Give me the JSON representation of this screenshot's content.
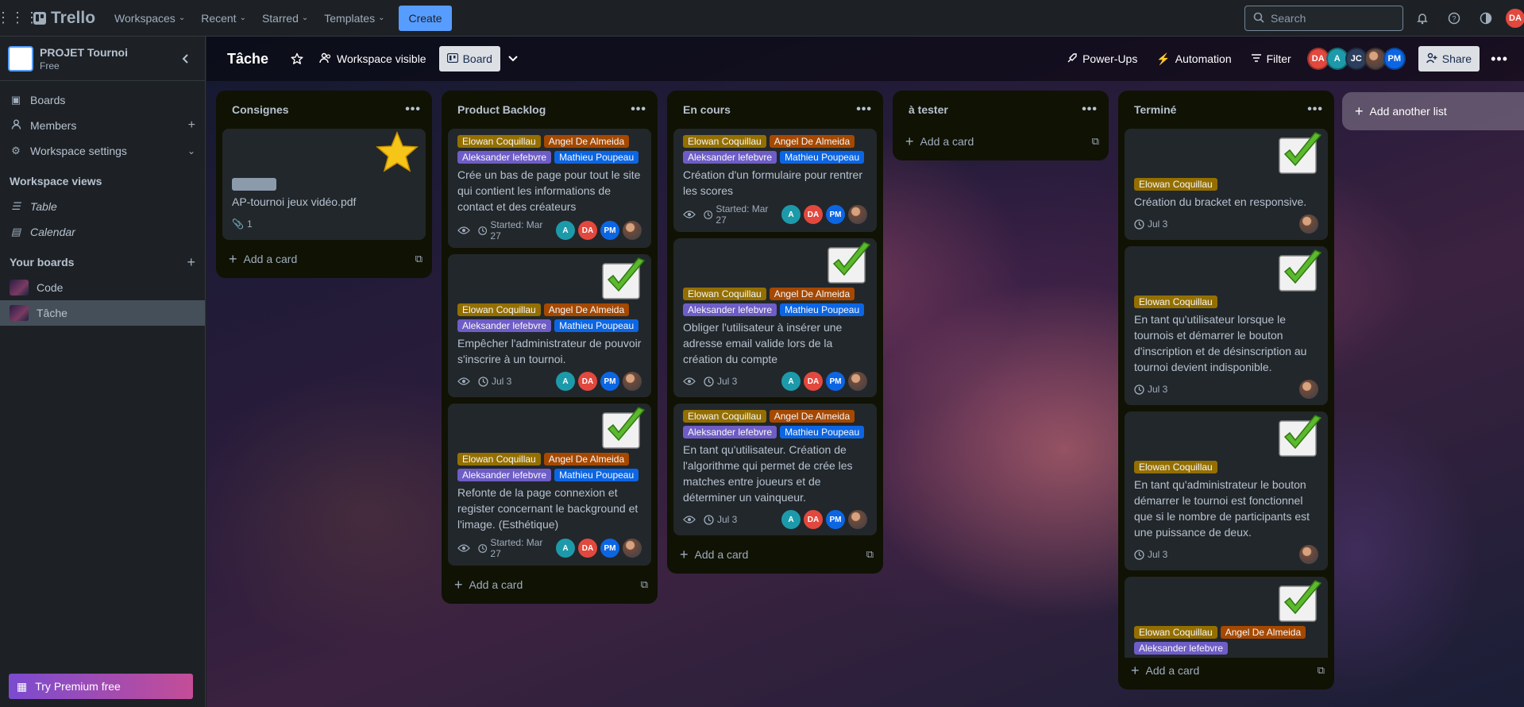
{
  "topnav": {
    "brand": "Trello",
    "menus": [
      "Workspaces",
      "Recent",
      "Starred",
      "Templates"
    ],
    "create_label": "Create",
    "search_placeholder": "Search",
    "user_initials": "DA"
  },
  "sidebar": {
    "workspace_name": "PROJET Tournoi",
    "workspace_plan": "Free",
    "items": [
      {
        "label": "Boards",
        "icon": "trello-icon"
      },
      {
        "label": "Members",
        "icon": "user-icon"
      },
      {
        "label": "Workspace settings",
        "icon": "gear-icon"
      }
    ],
    "views_heading": "Workspace views",
    "views": [
      {
        "label": "Table",
        "icon": "table-icon"
      },
      {
        "label": "Calendar",
        "icon": "calendar-icon"
      }
    ],
    "boards_heading": "Your boards",
    "boards": [
      {
        "label": "Code"
      },
      {
        "label": "Tâche"
      }
    ],
    "premium_label": "Try Premium free"
  },
  "board": {
    "title": "Tâche",
    "visibility_label": "Workspace visible",
    "view_label": "Board",
    "powerups_label": "Power-Ups",
    "automation_label": "Automation",
    "filter_label": "Filter",
    "share_label": "Share",
    "members": [
      {
        "initials": "DA",
        "color": "#e2483d"
      },
      {
        "initials": "A",
        "color": "#1d9aaa"
      },
      {
        "initials": "JC",
        "color": "#2c3e5d"
      },
      {
        "initials": "",
        "color": "#6d4a3a"
      },
      {
        "initials": "PM",
        "color": "#0c66e4"
      }
    ],
    "add_list_label": "Add another list"
  },
  "lists": [
    {
      "title": "Consignes",
      "add_card_label": "Add a card",
      "cards": [
        {
          "cover": "star",
          "title": "AP-tournoi jeux vidéo.pdf",
          "attachments": "1",
          "labels": [],
          "members": [],
          "date": ""
        }
      ]
    },
    {
      "title": "Product Backlog",
      "add_card_label": "Add a card",
      "cards": [
        {
          "cover": "",
          "labels": [
            "Elowan Coquillau",
            "Angel De Almeida",
            "Aleksander lefebvre",
            "Mathieu Poupeau"
          ],
          "title": "Crée un bas de page pour tout le site qui contient les informations de contact et des créateurs",
          "date": "Started: Mar 27",
          "members": [
            "A",
            "DA",
            "PM",
            "photo"
          ]
        },
        {
          "cover": "check",
          "labels": [
            "Elowan Coquillau",
            "Angel De Almeida",
            "Aleksander lefebvre",
            "Mathieu Poupeau"
          ],
          "title": "Empêcher l'administrateur de pouvoir s'inscrire à un tournoi.",
          "date": "Jul 3",
          "members": [
            "A",
            "DA",
            "PM",
            "photo"
          ]
        },
        {
          "cover": "check",
          "labels": [
            "Elowan Coquillau",
            "Angel De Almeida",
            "Aleksander lefebvre",
            "Mathieu Poupeau"
          ],
          "title": "Refonte de la page connexion et register concernant le background et l'image. (Esthétique)",
          "date": "Started: Mar 27",
          "members": [
            "A",
            "DA",
            "PM",
            "photo"
          ]
        }
      ]
    },
    {
      "title": "En cours",
      "add_card_label": "Add a card",
      "cards": [
        {
          "cover": "",
          "labels": [
            "Elowan Coquillau",
            "Angel De Almeida",
            "Aleksander lefebvre",
            "Mathieu Poupeau"
          ],
          "title": "Création d'un formulaire pour rentrer les scores",
          "date": "Started: Mar 27",
          "members": [
            "A",
            "DA",
            "PM",
            "photo"
          ]
        },
        {
          "cover": "check",
          "labels": [
            "Elowan Coquillau",
            "Angel De Almeida",
            "Aleksander lefebvre",
            "Mathieu Poupeau"
          ],
          "title": "Obliger l'utilisateur à insérer une adresse email valide lors de la création du compte",
          "date": "Jul 3",
          "members": [
            "A",
            "DA",
            "PM",
            "photo"
          ]
        },
        {
          "cover": "",
          "labels": [
            "Elowan Coquillau",
            "Angel De Almeida",
            "Aleksander lefebvre",
            "Mathieu Poupeau"
          ],
          "title": "En tant qu'utilisateur. Création de l'algorithme qui permet de crée les matches entre joueurs et de déterminer un vainqueur.",
          "date": "Jul 3",
          "members": [
            "A",
            "DA",
            "PM",
            "photo"
          ]
        }
      ]
    },
    {
      "title": "à tester",
      "add_card_label": "Add a card",
      "cards": []
    },
    {
      "title": "Terminé",
      "add_card_label": "Add a card",
      "cards": [
        {
          "cover": "check",
          "labels": [
            "Elowan Coquillau"
          ],
          "title": "Création du bracket en responsive.",
          "date": "Jul 3",
          "members": [
            "photo"
          ]
        },
        {
          "cover": "check",
          "labels": [
            "Elowan Coquillau"
          ],
          "title": "En tant qu'utilisateur lorsque le tournois et démarrer le bouton d'inscription et de désinscription au tournoi devient indisponible.",
          "date": "Jul 3",
          "members": [
            "photo"
          ]
        },
        {
          "cover": "check",
          "labels": [
            "Elowan Coquillau"
          ],
          "title": "En tant qu'administrateur le bouton démarrer le tournoi est fonctionnel que si le nombre de participants est une puissance de deux.",
          "date": "Jul 3",
          "members": [
            "photo"
          ]
        },
        {
          "cover": "check",
          "labels": [
            "Elowan Coquillau",
            "Angel De Almeida",
            "Aleksander lefebvre"
          ],
          "title": "",
          "date": "",
          "members": []
        }
      ]
    }
  ],
  "label_colors": {
    "Elowan Coquillau": "#946f00",
    "Angel De Almeida": "#a54800",
    "Aleksander lefebvre": "#6e5dc6",
    "Mathieu Poupeau": "#0c66e4"
  },
  "member_colors": {
    "A": "#1d9aaa",
    "DA": "#e2483d",
    "PM": "#0c66e4"
  }
}
